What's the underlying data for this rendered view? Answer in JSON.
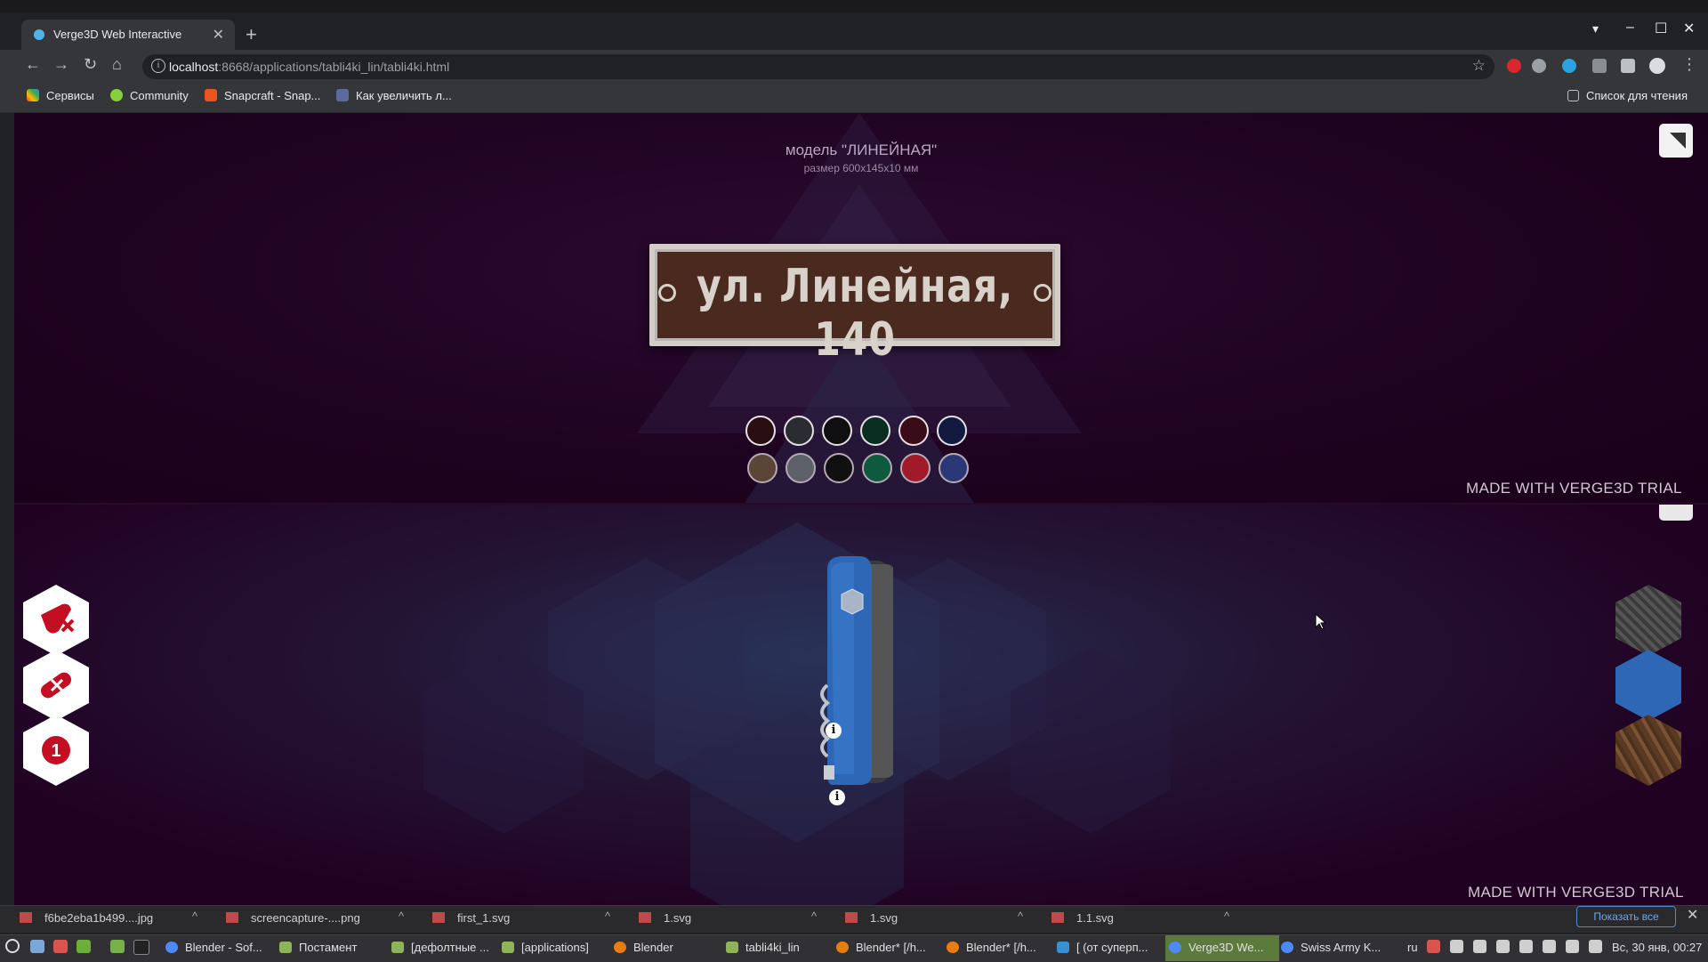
{
  "browser": {
    "tab_title": "Verge3D Web Interactive",
    "tab_close": "✕",
    "new_tab": "+",
    "url_host": "localhost",
    "url_rest": ":8668/applications/tabli4ki_lin/tabli4ki.html",
    "window_controls": {
      "minimize": "–",
      "maximize": "☐",
      "close": "✕"
    },
    "bookmarks": [
      "Сервисы",
      "Community",
      "Snapcraft - Snap...",
      "Как увеличить л..."
    ],
    "reading_list": "Список для чтения"
  },
  "page": {
    "model_title": "модель \"ЛИНЕЙНАЯ\"",
    "model_size": "размер 600x145x10 мм",
    "plate_text": "ул. Линейная, 140",
    "watermark_top": "MADE WITH VERGE3D TRIAL",
    "watermark_bottom": "MADE WITH VERGE3D TRIAL",
    "swatches_row1": [
      "#2a0f12",
      "#2a2c32",
      "#0f0f12",
      "#0b2e22",
      "#3a0c1a",
      "#131a40"
    ],
    "swatches_row2": [
      "#5a4536",
      "#5d6068",
      "#101010",
      "#0e5a3e",
      "#a01a2a",
      "#2a3878"
    ],
    "left_buttons": [
      "knife-tools-icon",
      "knife-remove-icon",
      "number-one-icon"
    ],
    "left_button_number": "1",
    "material_buttons": [
      "carbon-fiber",
      "blue-plastic",
      "wood"
    ],
    "info_marker": "i"
  },
  "downloads": {
    "items": [
      "f6be2eba1b499....jpg",
      "screencapture-....png",
      "first_1.svg",
      "1.svg",
      "1.svg",
      "1.1.svg"
    ],
    "show_all": "Показать все",
    "close": "✕"
  },
  "taskbar": {
    "items": [
      "Blender - Sof...",
      "Постамент",
      "[дефолтные ...",
      "[applications]",
      "Blender",
      "tabli4ki_lin",
      "Blender* [/h...",
      "Blender* [/h...",
      "[ (от суперп...",
      "Verge3D We...",
      "Swiss Army K..."
    ],
    "lang": "ru",
    "clock": "Вс, 30 янв, 00:27"
  }
}
